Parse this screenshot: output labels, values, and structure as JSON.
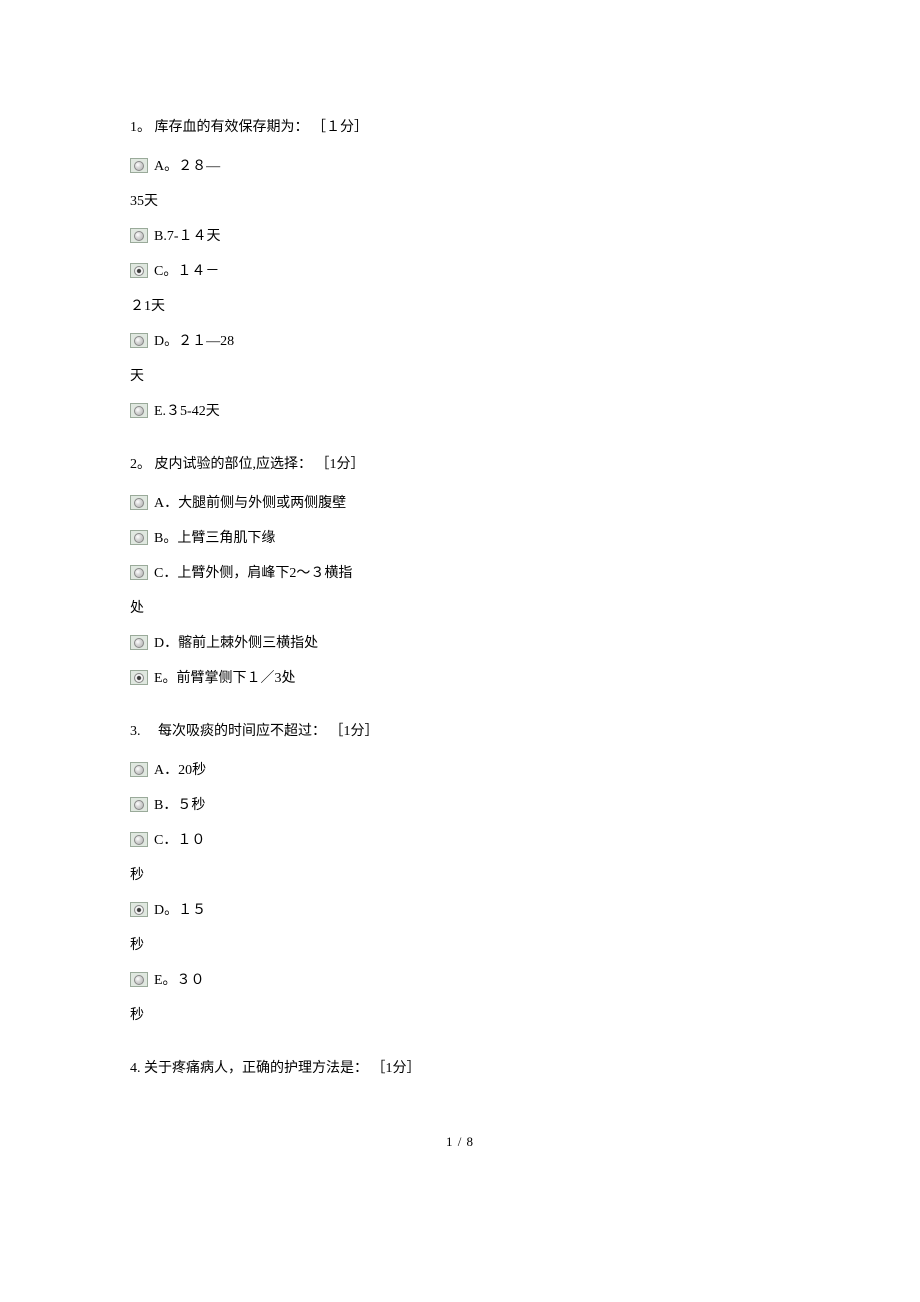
{
  "questions": [
    {
      "number": "1。",
      "text": "库存血的有效保存期为：",
      "points": "［１分］",
      "options": [
        {
          "letter": "A。",
          "text": "２８—",
          "wrap": "35天",
          "selected": false
        },
        {
          "letter": "B.",
          "text": "7-１４天",
          "selected": false
        },
        {
          "letter": "C。",
          "text": "１４－",
          "wrap": "２1天",
          "selected": true
        },
        {
          "letter": "D。",
          "text": "２１—28",
          "wrap": "天",
          "selected": false
        },
        {
          "letter": "E.",
          "text": "３5-42天",
          "selected": false
        }
      ]
    },
    {
      "number": "2。",
      "text": "皮内试验的部位,应选择：",
      "points": "［1分］",
      "options": [
        {
          "letter": "A．",
          "text": "大腿前侧与外侧或两侧腹壁",
          "selected": false
        },
        {
          "letter": "B。",
          "text": "上臂三角肌下缘",
          "selected": false
        },
        {
          "letter": "C．",
          "text": "上臂外侧，肩峰下2～３横指",
          "wrap": "处",
          "selected": false
        },
        {
          "letter": "D．",
          "text": "髂前上棘外侧三横指处",
          "selected": false
        },
        {
          "letter": "E。",
          "text": "前臂掌侧下１／3处",
          "selected": true
        }
      ]
    },
    {
      "number": "3.　",
      "text": "每次吸痰的时间应不超过：",
      "points": "［1分］",
      "options": [
        {
          "letter": "A．",
          "text": "20秒",
          "selected": false
        },
        {
          "letter": "B．",
          "text": "５秒",
          "selected": false
        },
        {
          "letter": "C．",
          "text": "１０",
          "wrap": "秒",
          "selected": false
        },
        {
          "letter": "D。",
          "text": "１５",
          "wrap": "秒",
          "selected": true
        },
        {
          "letter": "E。",
          "text": "３０",
          "wrap": "秒",
          "selected": false
        }
      ]
    },
    {
      "number": "4.",
      "text": "关于疼痛病人，正确的护理方法是：",
      "points": "［1分］",
      "options": []
    }
  ],
  "footer": "1 / 8"
}
